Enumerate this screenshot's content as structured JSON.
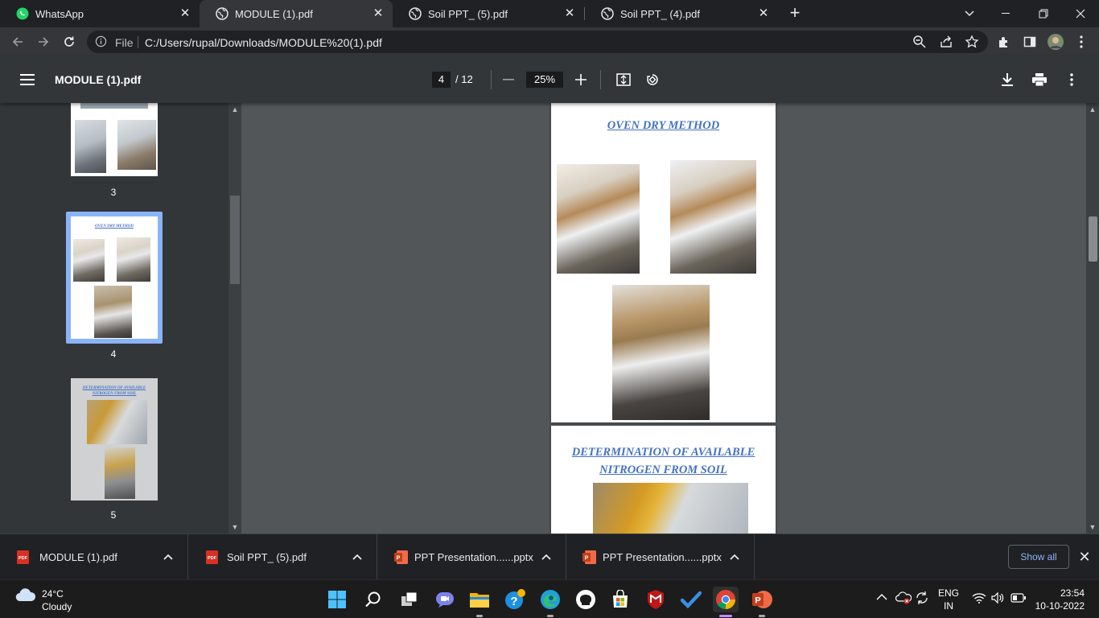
{
  "browser": {
    "tabs": [
      {
        "title": "WhatsApp",
        "active": false
      },
      {
        "title": "MODULE (1).pdf",
        "active": true
      },
      {
        "title": "Soil PPT_ (5).pdf",
        "active": false
      },
      {
        "title": "Soil PPT_ (4).pdf",
        "active": false
      }
    ],
    "address": {
      "scheme_label": "File",
      "url": "C:/Users/rupal/Downloads/MODULE%20(1).pdf"
    }
  },
  "pdf_viewer": {
    "title": "MODULE (1).pdf",
    "current_page": "4",
    "total_pages": "/ 12",
    "zoom": "25%",
    "thumbnails": [
      {
        "label": "3",
        "selected": false
      },
      {
        "label": "4",
        "selected": true,
        "heading": "OVEN DRY METHOD"
      },
      {
        "label": "5",
        "selected": false,
        "heading": "DETERMINATION OF AVAILABLE NITROGEN FROM SOIL"
      }
    ],
    "pages": [
      {
        "heading": "OVEN DRY METHOD"
      },
      {
        "heading_line1": "DETERMINATION OF AVAILABLE",
        "heading_line2": "NITROGEN FROM SOIL"
      }
    ]
  },
  "downloads": {
    "items": [
      {
        "name": "MODULE (1).pdf",
        "type": "pdf"
      },
      {
        "name": "Soil PPT_ (5).pdf",
        "type": "pdf"
      },
      {
        "name": "PPT Presentation......pptx",
        "type": "pptx"
      },
      {
        "name": "PPT Presentation......pptx",
        "type": "pptx"
      }
    ],
    "show_all": "Show all"
  },
  "taskbar": {
    "weather": {
      "temp": "24°C",
      "condition": "Cloudy"
    },
    "language": {
      "line1": "ENG",
      "line2": "IN"
    },
    "time": "23:54",
    "date": "10-10-2022"
  },
  "colors": {
    "accent_blue": "#8ab4f8",
    "heading_blue": "#4472c4",
    "thumb_selected": "#8ab4f8"
  }
}
